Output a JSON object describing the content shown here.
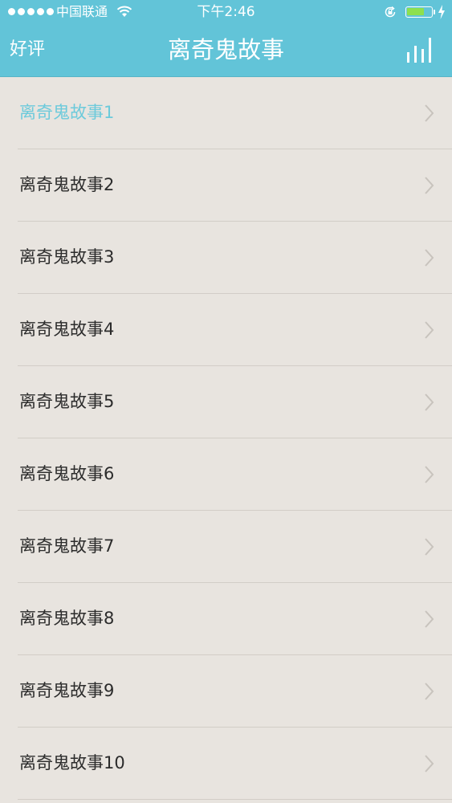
{
  "status_bar": {
    "carrier": "中国联通",
    "time": "下午2:46",
    "battery_level": 0.72,
    "battery_color": "#8ee04e"
  },
  "nav": {
    "left_button": "好评",
    "title": "离奇鬼故事",
    "right_icon": "bar-chart-icon",
    "background": "#62c4d8"
  },
  "list": {
    "active_color": "#6ccadb",
    "items": [
      {
        "label": "离奇鬼故事1",
        "active": true
      },
      {
        "label": "离奇鬼故事2",
        "active": false
      },
      {
        "label": "离奇鬼故事3",
        "active": false
      },
      {
        "label": "离奇鬼故事4",
        "active": false
      },
      {
        "label": "离奇鬼故事5",
        "active": false
      },
      {
        "label": "离奇鬼故事6",
        "active": false
      },
      {
        "label": "离奇鬼故事7",
        "active": false
      },
      {
        "label": "离奇鬼故事8",
        "active": false
      },
      {
        "label": "离奇鬼故事9",
        "active": false
      },
      {
        "label": "离奇鬼故事10",
        "active": false
      }
    ]
  }
}
